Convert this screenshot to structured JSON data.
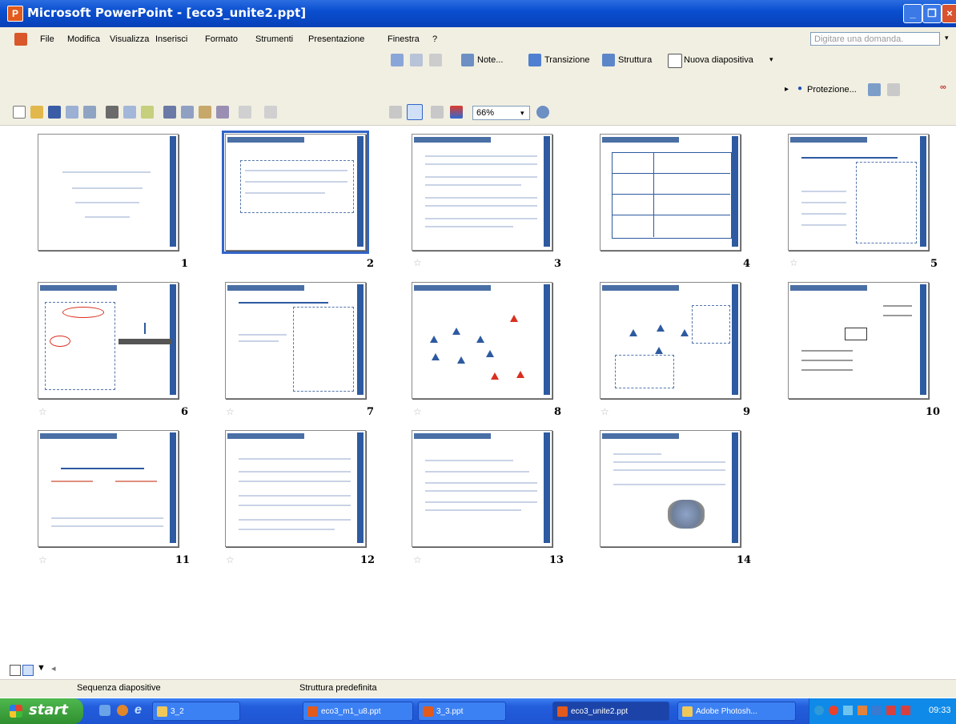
{
  "window": {
    "title": "Microsoft PowerPoint - [eco3_unite2.ppt]"
  },
  "menu": [
    "File",
    "Modifica",
    "Visualizza",
    "Inserisci",
    "Formato",
    "Strumenti",
    "Presentazione",
    "Finestra",
    "?"
  ],
  "help_placeholder": "Digitare una domanda.",
  "toolbar": {
    "note": "Note...",
    "transizione": "Transizione",
    "struttura": "Struttura",
    "nuova_diapositiva": "Nuova diapositiva",
    "protezione": "Protezione...",
    "zoom": "66%"
  },
  "slides": [
    {
      "num": "1"
    },
    {
      "num": "2"
    },
    {
      "num": "3"
    },
    {
      "num": "4"
    },
    {
      "num": "5"
    },
    {
      "num": "6"
    },
    {
      "num": "7"
    },
    {
      "num": "8"
    },
    {
      "num": "9"
    },
    {
      "num": "10"
    },
    {
      "num": "11"
    },
    {
      "num": "12"
    },
    {
      "num": "13"
    },
    {
      "num": "14"
    }
  ],
  "status": {
    "left": "Sequenza diapositive",
    "right": "Struttura predefinita"
  },
  "taskbar": {
    "start": "start",
    "items": [
      "3_2",
      "eco3_m1_u8.ppt",
      "3_3.ppt",
      "eco3_unite2.ppt",
      "Adobe Photosh..."
    ],
    "clock": "09:33"
  },
  "colors": {
    "titlebar": "#0a4fd0",
    "selection": "#3264c8",
    "slide_bar": "#2d5aa0",
    "taskbar": "#245edc"
  }
}
